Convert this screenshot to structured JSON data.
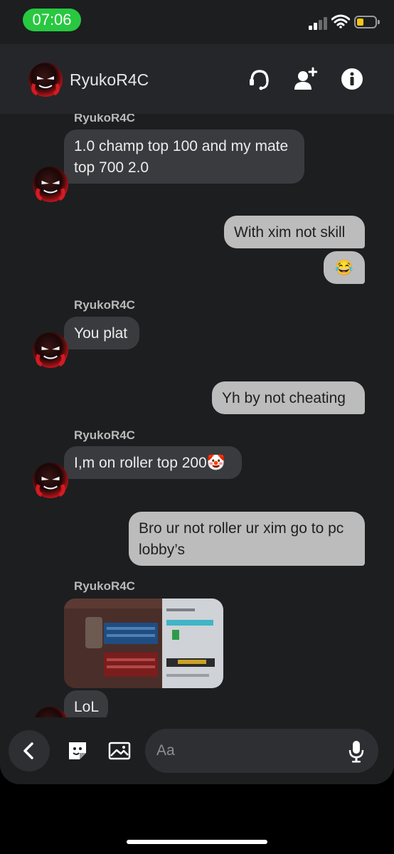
{
  "status_bar": {
    "time": "07:06",
    "time_pill_color": "#28c840",
    "battery_color": "#f5c518"
  },
  "header": {
    "contact_name": "RyukoR4C",
    "icons": [
      "headset-icon",
      "add-friend-icon",
      "info-icon"
    ]
  },
  "messages": [
    {
      "direction": "incoming",
      "sender": "RyukoR4C",
      "text": "1.0 champ top 100 and my mate top 700 2.0"
    },
    {
      "direction": "outgoing",
      "text": "With xim not skill"
    },
    {
      "direction": "outgoing",
      "text": "😂"
    },
    {
      "direction": "incoming",
      "sender": "RyukoR4C",
      "text": "You plat"
    },
    {
      "direction": "outgoing",
      "text": "Yh by not cheating"
    },
    {
      "direction": "incoming",
      "sender": "RyukoR4C",
      "text": "I,m on roller top 200🤡"
    },
    {
      "direction": "outgoing",
      "text": "Bro ur not roller ur xim go to pc lobby’s"
    },
    {
      "direction": "incoming",
      "sender": "RyukoR4C",
      "attachment": "screenshot-image",
      "text": "LoL"
    }
  ],
  "composer": {
    "placeholder": "Aa",
    "icons": [
      "back-icon",
      "sticker-icon",
      "image-icon",
      "microphone-icon"
    ]
  },
  "colors": {
    "background": "#1d1e20",
    "incoming_bubble": "#3a3b3f",
    "outgoing_bubble": "#bcbcbc"
  }
}
